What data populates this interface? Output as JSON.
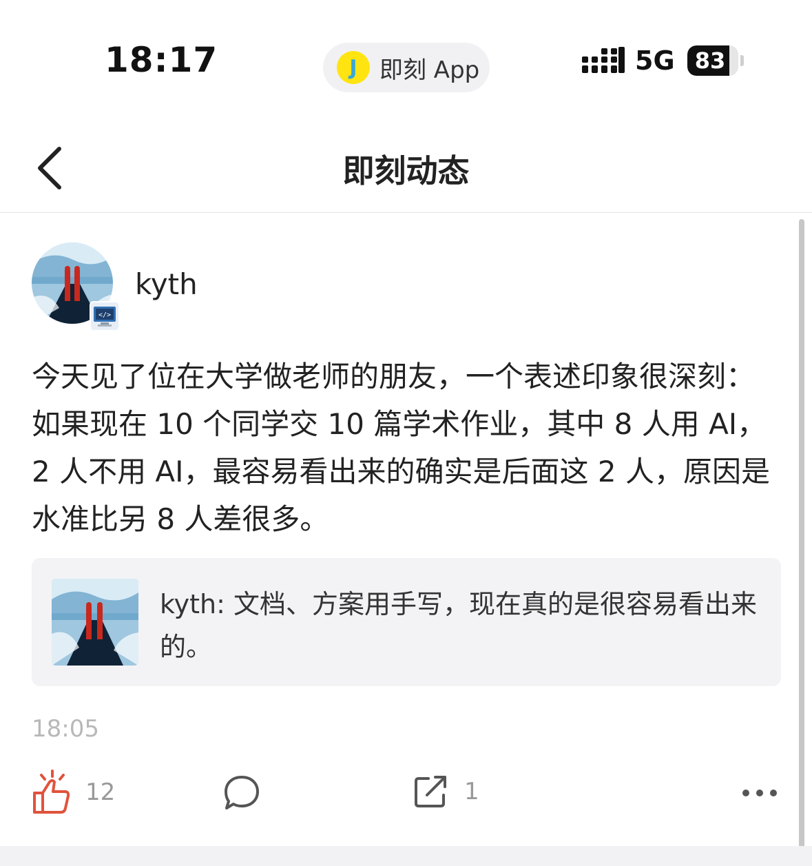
{
  "status_bar": {
    "time": "18:17",
    "app_pill": {
      "logo": "J",
      "name": "即刻 App"
    },
    "network": "5G",
    "battery": "83",
    "battery_level": 0.83
  },
  "nav": {
    "title": "即刻动态"
  },
  "post": {
    "username": "kyth",
    "text": "今天见了位在大学做老师的朋友，一个表述印象很深刻：如果现在 10 个同学交 10 篇学术作业，其中 8 人用 AI，2 人不用 AI，最容易看出来的确实是后面这 2 人，原因是水准比另 8 人差很多。",
    "quote": "kyth: 文档、方案用手写，现在真的是很容易看出来的。",
    "time": "18:05"
  },
  "actions": {
    "like_count": "12",
    "share_count": "1"
  },
  "colors": {
    "like": "#e0533b",
    "icon_gray": "#555555",
    "timestamp": "#b8b8b8",
    "app_logo_bg": "#ffe411"
  }
}
